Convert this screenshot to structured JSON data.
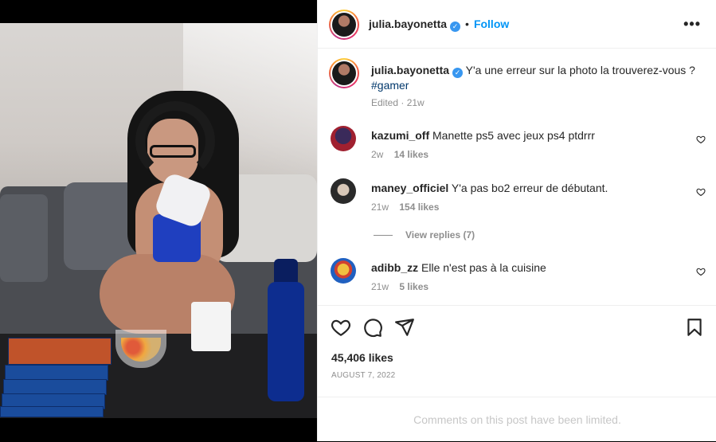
{
  "post": {
    "author": "julia.bayonetta",
    "follow_label": "Follow",
    "dot": "•",
    "more_label": "•••",
    "verified_mark": "✓"
  },
  "caption": {
    "username": "julia.bayonetta",
    "text": "Y'a une erreur sur la photo la trouverez-vous ?",
    "hashtag": "#gamer",
    "meta": "Edited · 21w"
  },
  "comments": [
    {
      "username": "kazumi_off",
      "text": "Manette ps5 avec jeux ps4 ptdrrr",
      "age": "2w",
      "likes": "14 likes"
    },
    {
      "username": "maney_officiel",
      "text": "Y'a pas bo2 erreur de débutant.",
      "age": "21w",
      "likes": "154 likes",
      "replies": "View replies (7)"
    },
    {
      "username": "adibb_zz",
      "text": "Elle n'est pas à la cuisine",
      "age": "21w",
      "likes": "5 likes"
    }
  ],
  "stats": {
    "likes": "45,406 likes",
    "date": "AUGUST 7, 2022"
  },
  "footer": {
    "limited": "Comments on this post have been limited."
  },
  "colors": {
    "link": "#0095f6",
    "hashtag": "#00376b",
    "verified": "#3897f0",
    "muted": "#8e8e8e"
  },
  "icons": [
    "heart-icon",
    "comment-icon",
    "share-icon",
    "bookmark-icon",
    "more-icon",
    "verified-icon"
  ]
}
